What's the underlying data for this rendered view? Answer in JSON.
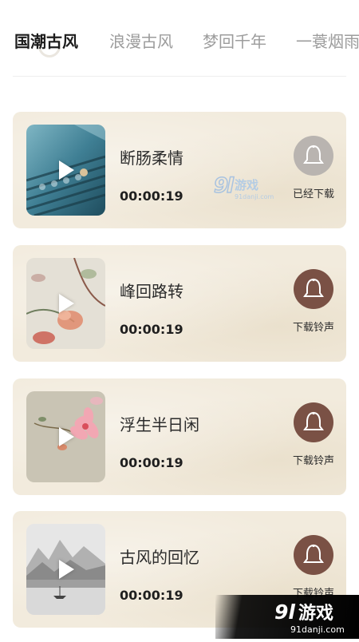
{
  "tabs": [
    {
      "label": "国潮古风",
      "active": true
    },
    {
      "label": "浪漫古风",
      "active": false
    },
    {
      "label": "梦回千年",
      "active": false
    },
    {
      "label": "一蓑烟雨",
      "active": false
    }
  ],
  "songs": [
    {
      "title": "断肠柔情",
      "duration": "00:00:19",
      "action_label": "已经下载",
      "downloaded": true,
      "thumb": "rooftop-tiles-image"
    },
    {
      "title": "峰回路转",
      "duration": "00:00:19",
      "action_label": "下载铃声",
      "downloaded": false,
      "thumb": "flower-painting-image"
    },
    {
      "title": "浮生半日闲",
      "duration": "00:00:19",
      "action_label": "下载铃声",
      "downloaded": false,
      "thumb": "pink-blossom-image"
    },
    {
      "title": "古风的回忆",
      "duration": "00:00:19",
      "action_label": "下载铃声",
      "downloaded": false,
      "thumb": "ink-landscape-image"
    }
  ],
  "colors": {
    "card_bg": "#f2ebdd",
    "bell_active": "#7a5145",
    "bell_downloaded": "#b9b4b0",
    "tab_active": "#1d1d1d",
    "tab_inactive": "#9c9c9c"
  },
  "watermark": {
    "logo_text": "91游戏",
    "url_text": "91danji.com"
  }
}
